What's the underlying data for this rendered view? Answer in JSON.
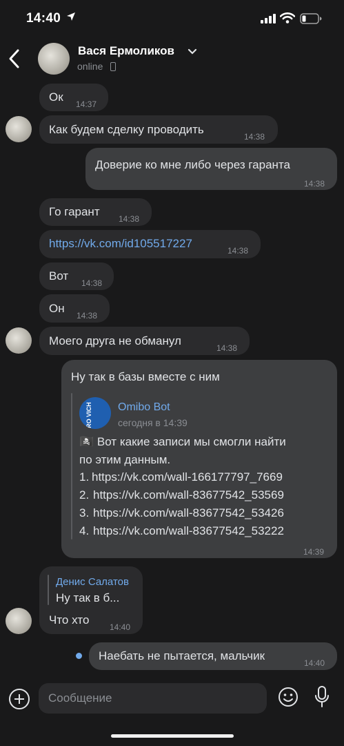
{
  "status_bar": {
    "time": "14:40"
  },
  "header": {
    "name": "Вася Ермоликов",
    "status": "online"
  },
  "messages": [
    {
      "dir": "in",
      "text": "Ок",
      "time": "14:37"
    },
    {
      "dir": "in",
      "text": "Как будем сделку проводить",
      "time": "14:38"
    },
    {
      "dir": "out",
      "text": "Доверие ко мне либо через гаранта",
      "time": "14:38"
    },
    {
      "dir": "in",
      "text": "Го гарант",
      "time": "14:38"
    },
    {
      "dir": "in",
      "text": "https://vk.com/id105517227",
      "time": "14:38"
    },
    {
      "dir": "in",
      "text": "Вот",
      "time": "14:38"
    },
    {
      "dir": "in",
      "text": "Он",
      "time": "14:38"
    },
    {
      "dir": "in",
      "text": "Моего друга не обманул",
      "time": "14:38"
    },
    {
      "dir": "out",
      "text": "Ну так в базы вместе с ним",
      "time": "14:39",
      "forwarded": {
        "author": "Omibo Bot",
        "avatar_text": "PRO VICH",
        "date": "сегодня в 14:39",
        "line1": "🏴‍☠️ Вот какие записи мы смогли найти",
        "line2": "по этим данным.",
        "items": [
          {
            "num": "1.",
            "url": "https://vk.com/wall-166177797_7669"
          },
          {
            "num": "2.",
            "url": "https://vk.com/wall-83677542_53569"
          },
          {
            "num": "3.",
            "url": "https://vk.com/wall-83677542_53426"
          },
          {
            "num": "4.",
            "url": "https://vk.com/wall-83677542_53222"
          }
        ]
      }
    },
    {
      "dir": "in",
      "reply": {
        "author": "Денис Салатов",
        "text": "Ну так в б..."
      },
      "text": "Что хто",
      "time": "14:40"
    },
    {
      "dir": "out",
      "text": "Наебать не пытается, мальчик",
      "time": "14:40",
      "unread": true
    }
  ],
  "composer": {
    "placeholder": "Сообщение"
  }
}
